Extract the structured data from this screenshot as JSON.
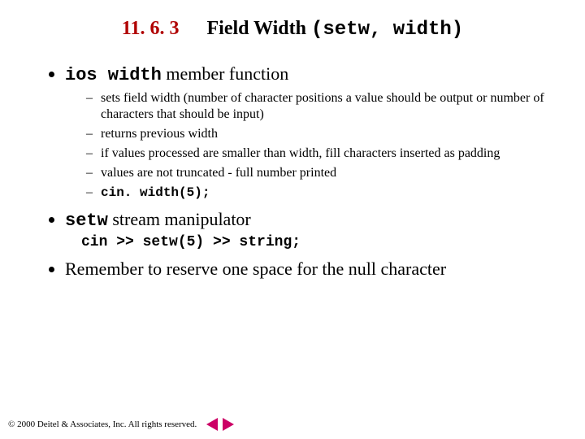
{
  "title": {
    "section_number": "11. 6. 3",
    "text_plain": "Field Width",
    "text_mono": "(setw, width)"
  },
  "bullets": {
    "b1": {
      "mono": "ios width",
      "rest": " member function"
    },
    "b1_sub": [
      "sets field width (number of character positions a value should be output or number of characters that should be input)",
      "returns previous width",
      "if values processed are smaller than width, fill characters inserted as padding",
      "values are not truncated - full number printed"
    ],
    "b1_sub_code": "cin. width(5);",
    "b2": {
      "mono": "setw",
      "rest": " stream manipulator"
    },
    "b2_code": "cin >> setw(5) >> string;",
    "b3": "Remember to reserve one space for the null character"
  },
  "footer": {
    "copyright": "© 2000 Deitel & Associates, Inc.  All rights reserved."
  }
}
